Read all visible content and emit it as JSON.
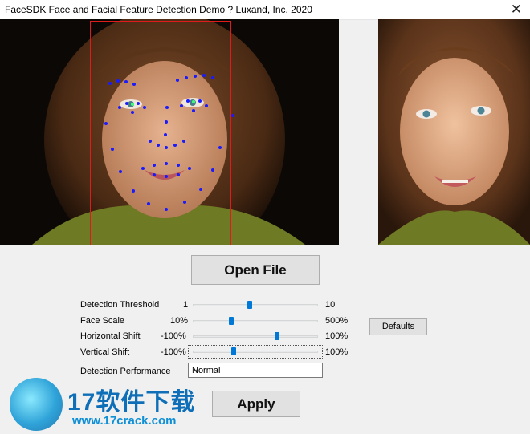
{
  "window": {
    "title": "FaceSDK Face and Facial Feature Detection Demo ? Luxand, Inc. 2020",
    "close_glyph": "✕"
  },
  "images": {
    "left": "detected-face-photo",
    "right": "original-face-photo",
    "facebox_color": "#e01b1b",
    "landmark_color": "#1a1aff"
  },
  "buttons": {
    "open_file": "Open File",
    "defaults": "Defaults",
    "apply": "Apply"
  },
  "controls": {
    "detection_threshold": {
      "label": "Detection Threshold",
      "min": "1",
      "max": "10",
      "level": 0.45
    },
    "face_scale": {
      "label": "Face Scale",
      "min": "10%",
      "max": "500%",
      "level": 0.3
    },
    "horizontal_shift": {
      "label": "Horizontal Shift",
      "min": "-100%",
      "max": "100%",
      "level": 0.68
    },
    "vertical_shift": {
      "label": "Vertical Shift",
      "min": "-100%",
      "max": "100%",
      "level": 0.32
    },
    "performance": {
      "label": "Detection Performance",
      "value": "Normal"
    }
  },
  "watermark": {
    "text": "17软件下载",
    "url": "www.17crack.com"
  },
  "accent": "#0078d7"
}
